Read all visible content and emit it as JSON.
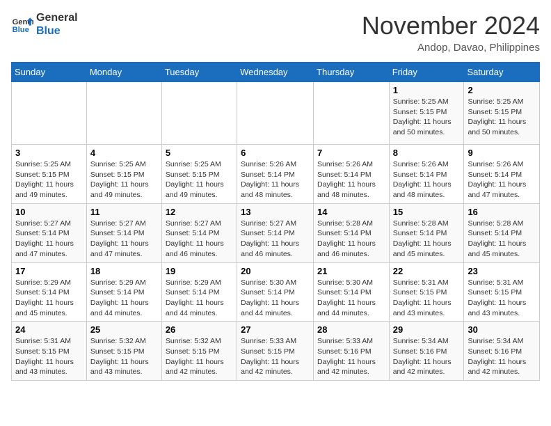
{
  "header": {
    "logo_line1": "General",
    "logo_line2": "Blue",
    "month": "November 2024",
    "location": "Andop, Davao, Philippines"
  },
  "weekdays": [
    "Sunday",
    "Monday",
    "Tuesday",
    "Wednesday",
    "Thursday",
    "Friday",
    "Saturday"
  ],
  "weeks": [
    [
      {
        "day": "",
        "text": ""
      },
      {
        "day": "",
        "text": ""
      },
      {
        "day": "",
        "text": ""
      },
      {
        "day": "",
        "text": ""
      },
      {
        "day": "",
        "text": ""
      },
      {
        "day": "1",
        "text": "Sunrise: 5:25 AM\nSunset: 5:15 PM\nDaylight: 11 hours and 50 minutes."
      },
      {
        "day": "2",
        "text": "Sunrise: 5:25 AM\nSunset: 5:15 PM\nDaylight: 11 hours and 50 minutes."
      }
    ],
    [
      {
        "day": "3",
        "text": "Sunrise: 5:25 AM\nSunset: 5:15 PM\nDaylight: 11 hours and 49 minutes."
      },
      {
        "day": "4",
        "text": "Sunrise: 5:25 AM\nSunset: 5:15 PM\nDaylight: 11 hours and 49 minutes."
      },
      {
        "day": "5",
        "text": "Sunrise: 5:25 AM\nSunset: 5:15 PM\nDaylight: 11 hours and 49 minutes."
      },
      {
        "day": "6",
        "text": "Sunrise: 5:26 AM\nSunset: 5:14 PM\nDaylight: 11 hours and 48 minutes."
      },
      {
        "day": "7",
        "text": "Sunrise: 5:26 AM\nSunset: 5:14 PM\nDaylight: 11 hours and 48 minutes."
      },
      {
        "day": "8",
        "text": "Sunrise: 5:26 AM\nSunset: 5:14 PM\nDaylight: 11 hours and 48 minutes."
      },
      {
        "day": "9",
        "text": "Sunrise: 5:26 AM\nSunset: 5:14 PM\nDaylight: 11 hours and 47 minutes."
      }
    ],
    [
      {
        "day": "10",
        "text": "Sunrise: 5:27 AM\nSunset: 5:14 PM\nDaylight: 11 hours and 47 minutes."
      },
      {
        "day": "11",
        "text": "Sunrise: 5:27 AM\nSunset: 5:14 PM\nDaylight: 11 hours and 47 minutes."
      },
      {
        "day": "12",
        "text": "Sunrise: 5:27 AM\nSunset: 5:14 PM\nDaylight: 11 hours and 46 minutes."
      },
      {
        "day": "13",
        "text": "Sunrise: 5:27 AM\nSunset: 5:14 PM\nDaylight: 11 hours and 46 minutes."
      },
      {
        "day": "14",
        "text": "Sunrise: 5:28 AM\nSunset: 5:14 PM\nDaylight: 11 hours and 46 minutes."
      },
      {
        "day": "15",
        "text": "Sunrise: 5:28 AM\nSunset: 5:14 PM\nDaylight: 11 hours and 45 minutes."
      },
      {
        "day": "16",
        "text": "Sunrise: 5:28 AM\nSunset: 5:14 PM\nDaylight: 11 hours and 45 minutes."
      }
    ],
    [
      {
        "day": "17",
        "text": "Sunrise: 5:29 AM\nSunset: 5:14 PM\nDaylight: 11 hours and 45 minutes."
      },
      {
        "day": "18",
        "text": "Sunrise: 5:29 AM\nSunset: 5:14 PM\nDaylight: 11 hours and 44 minutes."
      },
      {
        "day": "19",
        "text": "Sunrise: 5:29 AM\nSunset: 5:14 PM\nDaylight: 11 hours and 44 minutes."
      },
      {
        "day": "20",
        "text": "Sunrise: 5:30 AM\nSunset: 5:14 PM\nDaylight: 11 hours and 44 minutes."
      },
      {
        "day": "21",
        "text": "Sunrise: 5:30 AM\nSunset: 5:14 PM\nDaylight: 11 hours and 44 minutes."
      },
      {
        "day": "22",
        "text": "Sunrise: 5:31 AM\nSunset: 5:15 PM\nDaylight: 11 hours and 43 minutes."
      },
      {
        "day": "23",
        "text": "Sunrise: 5:31 AM\nSunset: 5:15 PM\nDaylight: 11 hours and 43 minutes."
      }
    ],
    [
      {
        "day": "24",
        "text": "Sunrise: 5:31 AM\nSunset: 5:15 PM\nDaylight: 11 hours and 43 minutes."
      },
      {
        "day": "25",
        "text": "Sunrise: 5:32 AM\nSunset: 5:15 PM\nDaylight: 11 hours and 43 minutes."
      },
      {
        "day": "26",
        "text": "Sunrise: 5:32 AM\nSunset: 5:15 PM\nDaylight: 11 hours and 42 minutes."
      },
      {
        "day": "27",
        "text": "Sunrise: 5:33 AM\nSunset: 5:15 PM\nDaylight: 11 hours and 42 minutes."
      },
      {
        "day": "28",
        "text": "Sunrise: 5:33 AM\nSunset: 5:16 PM\nDaylight: 11 hours and 42 minutes."
      },
      {
        "day": "29",
        "text": "Sunrise: 5:34 AM\nSunset: 5:16 PM\nDaylight: 11 hours and 42 minutes."
      },
      {
        "day": "30",
        "text": "Sunrise: 5:34 AM\nSunset: 5:16 PM\nDaylight: 11 hours and 42 minutes."
      }
    ]
  ]
}
